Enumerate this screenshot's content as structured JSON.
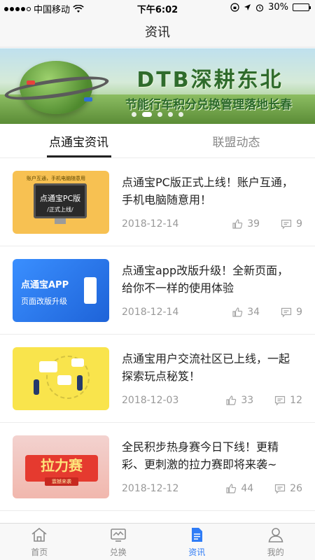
{
  "status_bar": {
    "carrier": "中国移动",
    "time": "下午6:02",
    "battery": "30%",
    "battery_level": 0.3
  },
  "header": {
    "title": "资讯"
  },
  "banner": {
    "title": "DTB深耕东北",
    "subtitle": "节能行车积分兑换管理落地长春",
    "slide_count": 5,
    "active_slide": 1
  },
  "tabs": [
    {
      "label": "点通宝资讯",
      "active": true
    },
    {
      "label": "联盟动态",
      "active": false
    }
  ],
  "articles": [
    {
      "thumb_text": "点通宝PC版",
      "thumb_sub": "/正式上线/",
      "thumb_top": "账户互通，手机电脑随意用",
      "title": "点通宝PC版正式上线！账户互通，手机电脑随意用！",
      "date": "2018-12-14",
      "likes": "39",
      "comments": "9"
    },
    {
      "thumb_text": "点通宝APP",
      "thumb_sub": "页面改版升级",
      "title": "点通宝app改版升级！全新页面，给你不一样的使用体验",
      "date": "2018-12-14",
      "likes": "34",
      "comments": "9"
    },
    {
      "title": "点通宝用户交流社区已上线，一起探索玩点秘笈！",
      "date": "2018-12-03",
      "likes": "33",
      "comments": "12"
    },
    {
      "thumb_text": "拉力赛",
      "thumb_sub": "震撼来袭",
      "title": "全民积步热身赛今日下线！更精彩、更刺激的拉力赛即将来袭~",
      "date": "2018-12-12",
      "likes": "44",
      "comments": "26"
    }
  ],
  "tabbar": [
    {
      "label": "首页",
      "icon": "home-icon",
      "active": false
    },
    {
      "label": "兑换",
      "icon": "exchange-icon",
      "active": false
    },
    {
      "label": "资讯",
      "icon": "document-icon",
      "active": true
    },
    {
      "label": "我的",
      "icon": "user-icon",
      "active": false
    }
  ],
  "colors": {
    "accent": "#2f7cf6",
    "tab_indicator": "#222222",
    "muted_text": "#999999"
  }
}
